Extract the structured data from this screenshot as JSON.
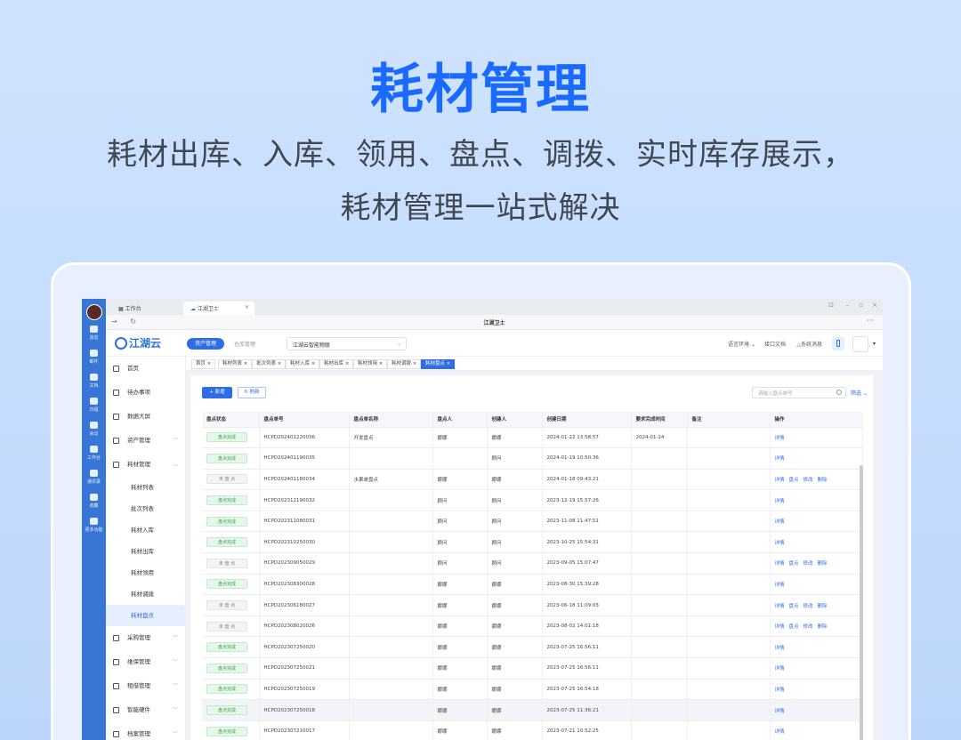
{
  "hero": {
    "title": "耗材管理",
    "line1": "耗材出库、入库、领用、盘点、调拨、实时库存展示，",
    "line2": "耗材管理一站式解决"
  },
  "window": {
    "tab1": "工作台",
    "tab2": "江湖卫士",
    "title": "江湖卫士"
  },
  "rail": [
    "消息",
    "邮件",
    "文档",
    "日程",
    "会议",
    "工作台",
    "通讯录",
    "收藏",
    "更多功能"
  ],
  "rail_badge": "2",
  "header": {
    "logo": "江湖云",
    "module_active": "资产管理",
    "module_2": "仓库管理",
    "project": "江湖云智能物联",
    "env": "语言环境",
    "api": "接口文档",
    "sysmsg": "系统消息"
  },
  "menu": {
    "items": [
      {
        "label": "首页"
      },
      {
        "label": "待办事项"
      },
      {
        "label": "数据大屏"
      },
      {
        "label": "资产管理"
      },
      {
        "label": "耗材管理"
      }
    ],
    "subs": [
      "耗材列表",
      "批次列表",
      "耗材入库",
      "耗材出库",
      "耗材领用",
      "耗材调拨",
      "耗材盘点"
    ],
    "items_after": [
      {
        "label": "采购管理"
      },
      {
        "label": "维保管理"
      },
      {
        "label": "租借管理"
      },
      {
        "label": "智能硬件"
      },
      {
        "label": "档案管理"
      }
    ]
  },
  "crumbs": [
    "首页",
    "耗材列表",
    "批次列表",
    "耗材入库",
    "耗材出库",
    "耗材领用",
    "耗材调拨",
    "耗材盘点"
  ],
  "toolbar": {
    "new": "+ 新增",
    "refresh": "刷新",
    "search_placeholder": "请输入盘点单号",
    "filter": "筛选"
  },
  "table": {
    "headers": [
      "盘点状态",
      "盘点单号",
      "盘点单名称",
      "盘点人",
      "创建人",
      "创建日期",
      "要求完成时间",
      "备注",
      "操作"
    ],
    "rows": [
      {
        "status": "盘点完成",
        "done": true,
        "no": "HCPD202401220036",
        "name": "开发盘点",
        "checker": "娜娜",
        "creator": "娜娜",
        "date": "2024-01-22 13:58:57",
        "due": "2024-01-24",
        "ops": [
          "详情"
        ]
      },
      {
        "status": "盘点完成",
        "done": true,
        "no": "HCPD202401190035",
        "name": "",
        "checker": "",
        "creator": "顾问",
        "date": "2024-01-19 10:50:36",
        "due": "",
        "ops": [
          "详情"
        ]
      },
      {
        "status": "未 盘 点",
        "done": false,
        "no": "HCPD202401180034",
        "name": "水果单盘点",
        "checker": "娜娜",
        "creator": "娜娜",
        "date": "2024-01-18 09:43:21",
        "due": "",
        "ops": [
          "详情",
          "盘点",
          "修改",
          "删除"
        ]
      },
      {
        "status": "盘点完成",
        "done": true,
        "no": "HCPD202312190032",
        "name": "",
        "checker": "顾问",
        "creator": "顾问",
        "date": "2023-12-19 15:57:26",
        "due": "",
        "ops": [
          "详情"
        ]
      },
      {
        "status": "盘点完成",
        "done": true,
        "no": "HCPD202311080031",
        "name": "",
        "checker": "顾问",
        "creator": "顾问",
        "date": "2023-11-08 11:47:51",
        "due": "",
        "ops": [
          "详情"
        ]
      },
      {
        "status": "盘点完成",
        "done": true,
        "no": "HCPD202310250030",
        "name": "",
        "checker": "顾问",
        "creator": "顾问",
        "date": "2023-10-25 15:54:31",
        "due": "",
        "ops": [
          "详情"
        ]
      },
      {
        "status": "未 盘 点",
        "done": false,
        "no": "HCPD202309050029",
        "name": "",
        "checker": "顾问",
        "creator": "顾问",
        "date": "2023-09-05 15:07:47",
        "due": "",
        "ops": [
          "详情",
          "盘点",
          "修改",
          "删除"
        ]
      },
      {
        "status": "盘点完成",
        "done": true,
        "no": "HCPD202308300028",
        "name": "",
        "checker": "娜娜",
        "creator": "娜娜",
        "date": "2023-08-30 15:39:28",
        "due": "",
        "ops": [
          "详情"
        ]
      },
      {
        "status": "未 盘 点",
        "done": false,
        "no": "HCPD202306180027",
        "name": "",
        "checker": "娜娜",
        "creator": "娜娜",
        "date": "2023-06-18 11:09:03",
        "due": "",
        "ops": [
          "详情",
          "盘点",
          "修改",
          "删除"
        ]
      },
      {
        "status": "未 盘 点",
        "done": false,
        "no": "HCPD202308020026",
        "name": "",
        "checker": "娜娜",
        "creator": "娜娜",
        "date": "2023-08-02 14:01:18",
        "due": "",
        "ops": [
          "详情",
          "盘点",
          "修改",
          "删除"
        ]
      },
      {
        "status": "盘点完成",
        "done": true,
        "no": "HCPD202307250020",
        "name": "",
        "checker": "娜娜",
        "creator": "娜娜",
        "date": "2023-07-25 16:56:11",
        "due": "",
        "ops": [
          "详情"
        ]
      },
      {
        "status": "盘点完成",
        "done": true,
        "no": "HCPD202307250021",
        "name": "",
        "checker": "娜娜",
        "creator": "娜娜",
        "date": "2023-07-25 16:56:11",
        "due": "",
        "ops": [
          "详情"
        ]
      },
      {
        "status": "盘点完成",
        "done": true,
        "no": "HCPD202307250019",
        "name": "",
        "checker": "娜娜",
        "creator": "娜娜",
        "date": "2023-07-25 16:54:18",
        "due": "",
        "ops": [
          "详情"
        ]
      },
      {
        "status": "盘点完成",
        "done": true,
        "no": "HCPD202307250018",
        "name": "",
        "checker": "娜娜",
        "creator": "娜娜",
        "date": "2023-07-25 11:36:21",
        "due": "",
        "ops": [
          "详情"
        ]
      },
      {
        "status": "盘点完成",
        "done": true,
        "no": "HCPD202307210017",
        "name": "",
        "checker": "娜娜",
        "creator": "娜娜",
        "date": "2023-07-21 10:52:25",
        "due": "",
        "ops": [
          "详情"
        ]
      }
    ]
  }
}
